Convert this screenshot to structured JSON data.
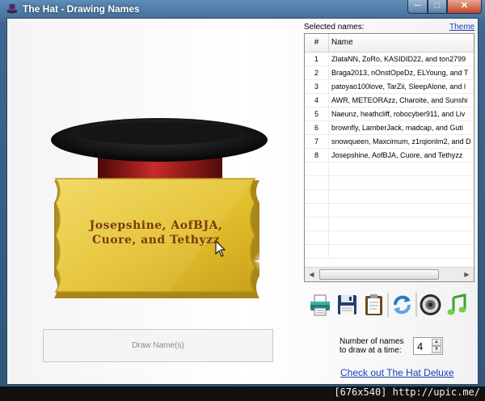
{
  "window": {
    "title": "The Hat - Drawing Names",
    "min_label": "─",
    "max_label": "□",
    "close_label": "✕"
  },
  "hat": {
    "ticket_line1": "Josepshine, AofBJA,",
    "ticket_line2": "Cuore, and Tethyzz"
  },
  "draw_button": {
    "label": "Draw Name(s)"
  },
  "list": {
    "label": "Selected names:",
    "theme_link": "Theme",
    "columns": {
      "num": "#",
      "name": "Name"
    },
    "rows": [
      {
        "num": "1",
        "name": "ZlataNN, ZoRo, KASIDID22, and ton2799"
      },
      {
        "num": "2",
        "name": "Braga2013, nOnstOpeDz, ELYoung, and T"
      },
      {
        "num": "3",
        "name": "patoyao100love, TarZii, SleepAlone, and l"
      },
      {
        "num": "4",
        "name": "AWR, METEORAzz, Charoite, and Sunshi"
      },
      {
        "num": "5",
        "name": "Naeunz, heathcliff, robocyber911, and Liv"
      },
      {
        "num": "6",
        "name": "brownfly, LamberJack, madcap, and Guti"
      },
      {
        "num": "7",
        "name": "snowqueen, Maxcimum, z1rqionlm2, and D"
      },
      {
        "num": "8",
        "name": "Josepshine, AofBJA, Cuore, and Tethyzz"
      }
    ]
  },
  "toolbar": {
    "icons": [
      "printer-icon",
      "save-icon",
      "clipboard-icon",
      "refresh-icon",
      "speaker-icon",
      "music-icon"
    ]
  },
  "draw_count": {
    "label_line1": "Number of names",
    "label_line2": "to draw at a time:",
    "value": "4"
  },
  "deluxe_link": "Check out The Hat Deluxe",
  "watermark": "[676x540] http://upic.me/",
  "colors": {
    "link": "#1b3db2",
    "ticket": "#e7c93a",
    "hat_band": "#b01c1c"
  }
}
